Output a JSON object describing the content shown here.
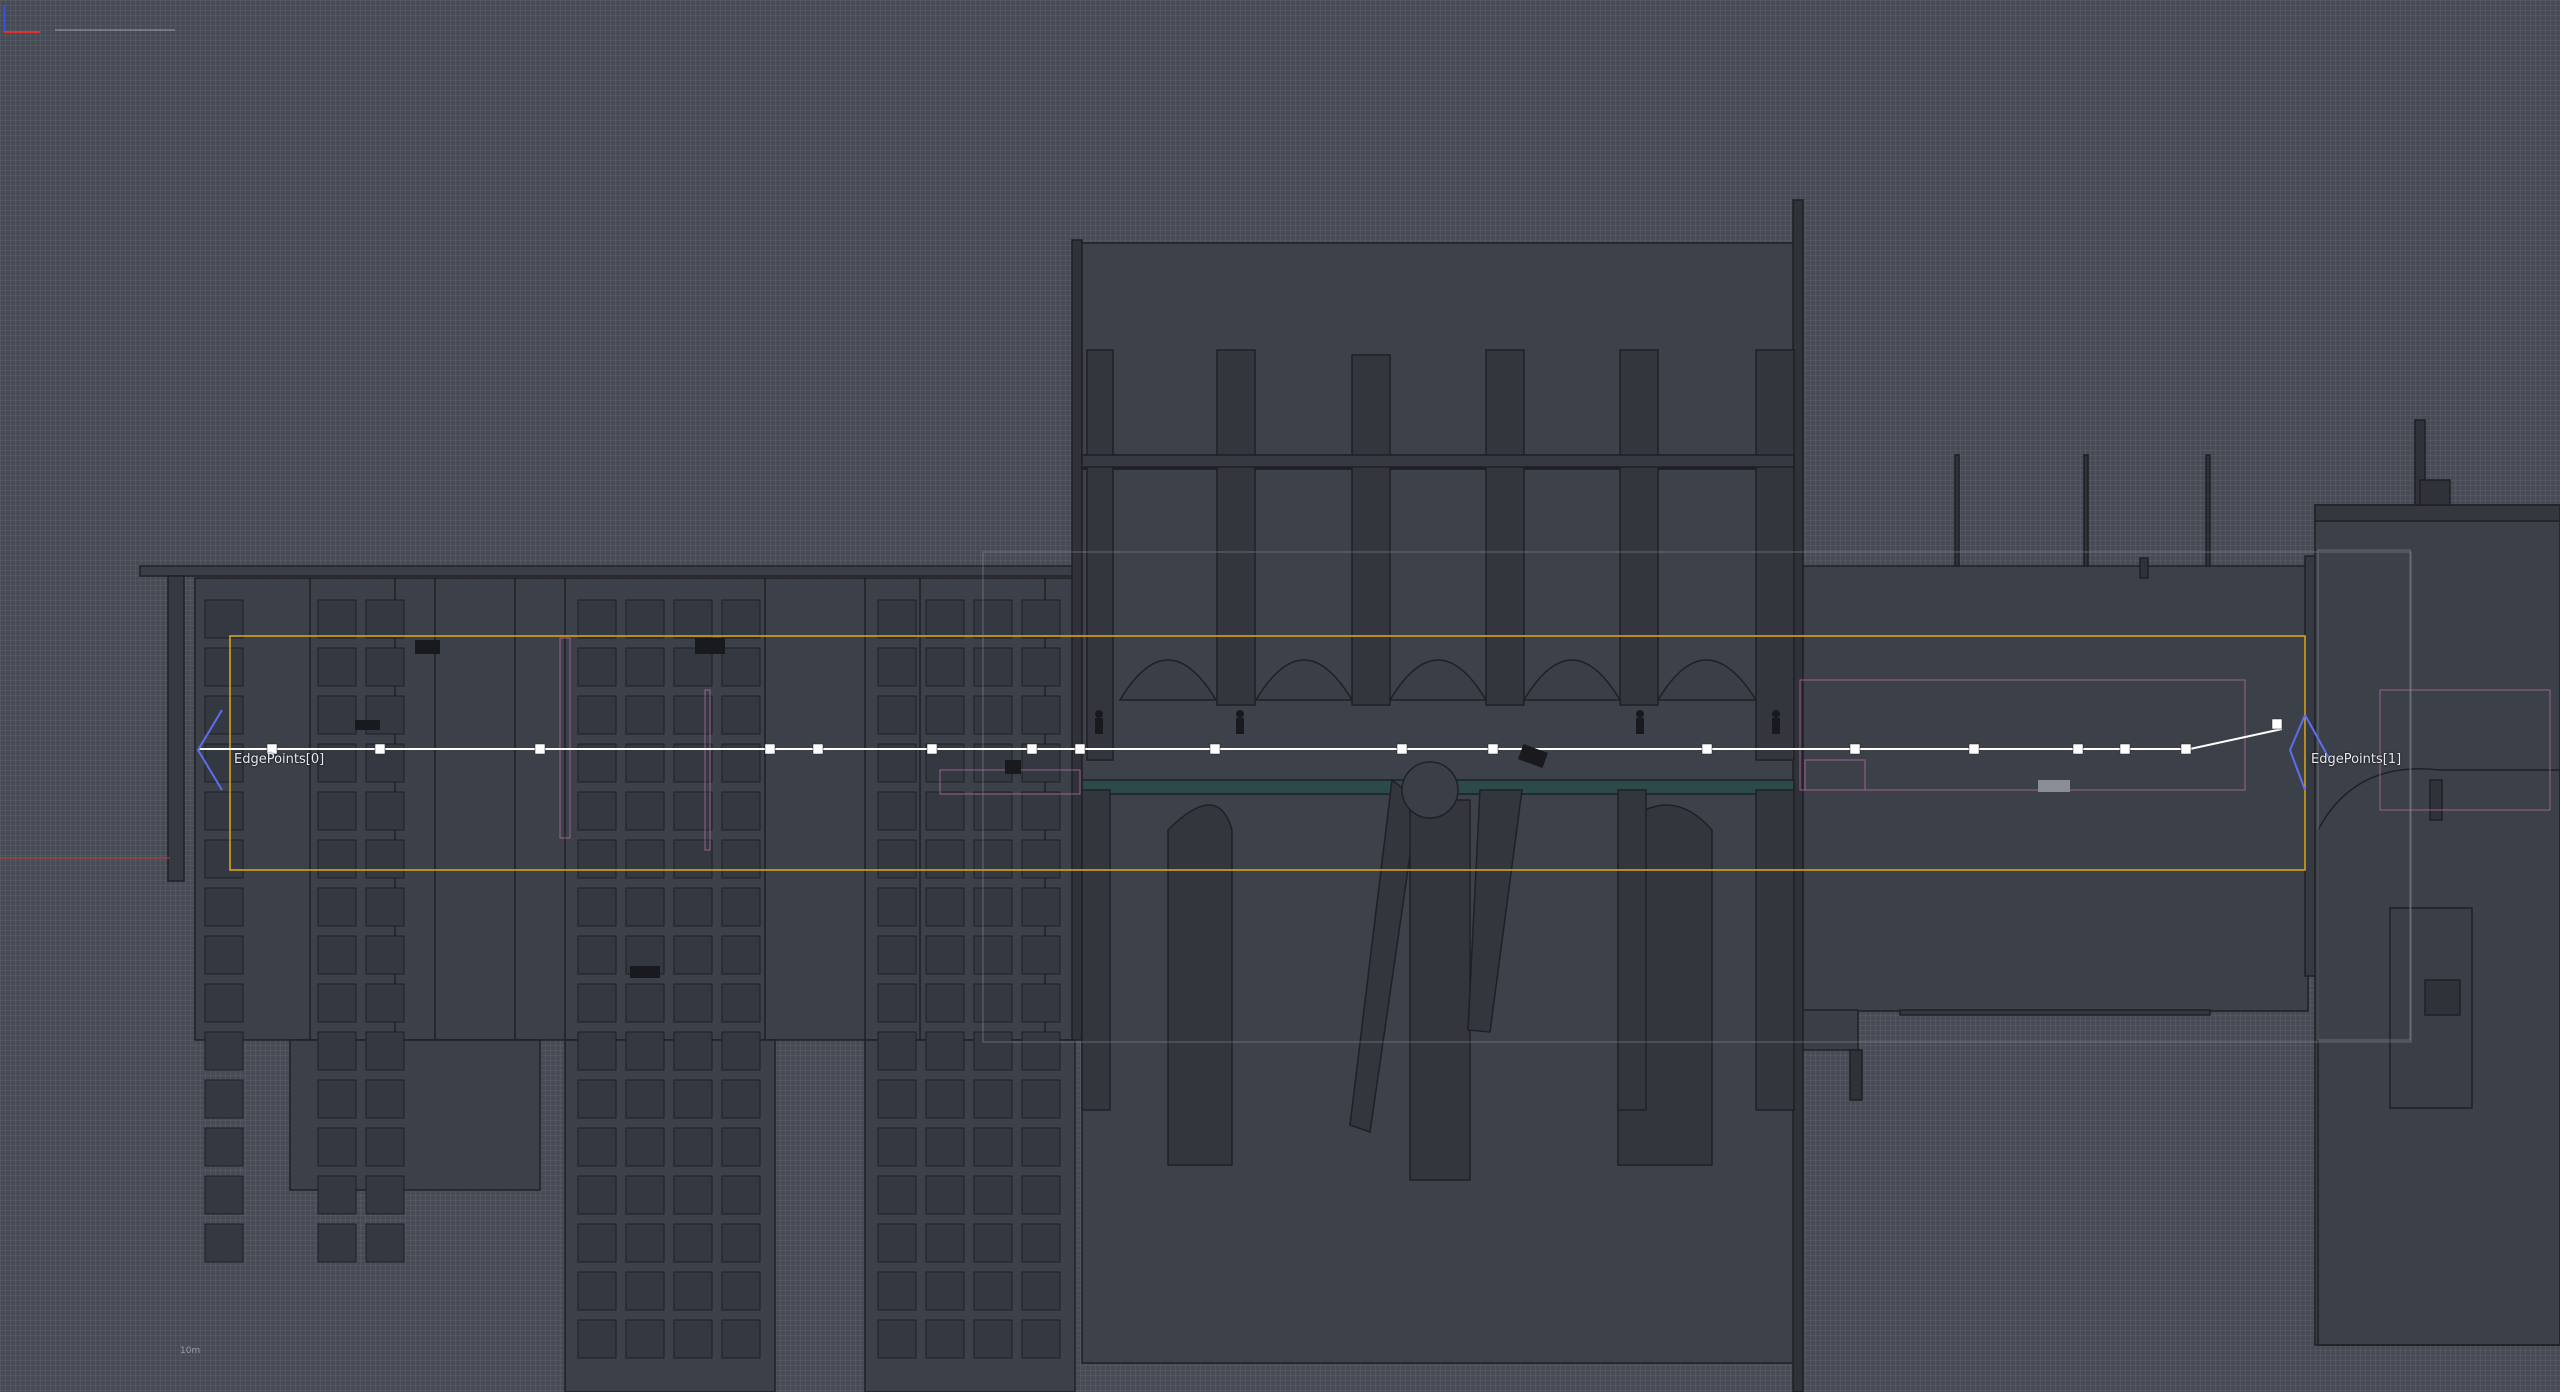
{
  "viewport": {
    "mode": "orthographic-side",
    "background_color": "#464b55",
    "grid_color": "#5a5f69",
    "geometry_fill": "#3c4048",
    "geometry_dark": "#33363d",
    "outline_color": "#1e2024",
    "volume_color": "#d9a21b",
    "spline_color": "#ffffff",
    "selection_pink": "#b46aa3"
  },
  "spline": {
    "edge_labels": [
      "EdgePoints[0]",
      "EdgePoints[1]"
    ],
    "point_count": 20
  },
  "axis_gizmo": {
    "axes": [
      "x",
      "z"
    ],
    "colors": {
      "x": "#e03030",
      "z": "#3050e0"
    },
    "scale_label": "10m"
  },
  "icons": [
    "character-actor-icon",
    "camera-actor-icon",
    "arrow-handle-icon"
  ]
}
